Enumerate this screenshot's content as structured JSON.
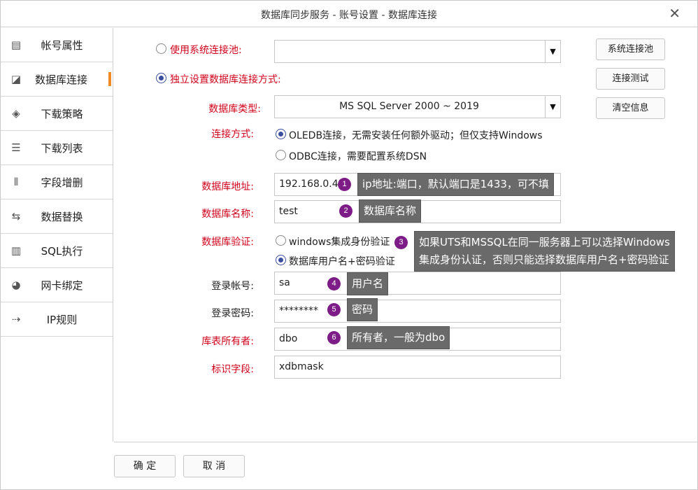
{
  "window": {
    "title": "数据库同步服务 - 账号设置 - 数据库连接",
    "close_symbol": "✕"
  },
  "sidebar": {
    "items": [
      {
        "label": "帐号属性",
        "icon": "id-card-icon",
        "glyph": "▤"
      },
      {
        "label": "数据库连接",
        "icon": "chart-line-icon",
        "glyph": "◪",
        "active": true
      },
      {
        "label": "下载策略",
        "icon": "diamond-icon",
        "glyph": "◈"
      },
      {
        "label": "下载列表",
        "icon": "list-icon",
        "glyph": "☰"
      },
      {
        "label": "字段增删",
        "icon": "columns-icon",
        "glyph": "⦀"
      },
      {
        "label": "数据替换",
        "icon": "swap-icon",
        "glyph": "⇆"
      },
      {
        "label": "SQL执行",
        "icon": "bar-chart-icon",
        "glyph": "▥"
      },
      {
        "label": "网卡绑定",
        "icon": "pie-icon",
        "glyph": "◕"
      },
      {
        "label": "IP规则",
        "icon": "route-icon",
        "glyph": "⇢"
      }
    ],
    "active_color": "#f08a24"
  },
  "connection": {
    "use_pool_label": "使用系统连接池:",
    "pool_value": "",
    "independent_label": "独立设置数据库连接方式:",
    "db_type_label": "数据库类型:",
    "db_type_value": "MS SQL Server 2000 ~ 2019",
    "conn_mode_label": "连接方式:",
    "oledb_option": "OLEDB连接，无需安装任何额外驱动；但仅支持Windows",
    "odbc_option": "ODBC连接，需要配置系统DSN",
    "address_label": "数据库地址:",
    "address_value": "192.168.0.43",
    "name_label": "数据库名称:",
    "name_value": "test",
    "auth_label": "数据库验证:",
    "auth_windows": "windows集成身份验证",
    "auth_user": "数据库用户名+密码验证",
    "login_label": "登录帐号:",
    "login_value": "sa",
    "password_label": "登录密码:",
    "password_value": "********",
    "owner_label": "库表所有者:",
    "owner_value": "dbo",
    "id_field_label": "标识字段:",
    "id_field_value": "xdbmask"
  },
  "buttons": {
    "pool": "系统连接池",
    "test": "连接测试",
    "clear": "清空信息",
    "ok": "确 定",
    "cancel": "取 消"
  },
  "tips": [
    {
      "num": "1",
      "text": "ip地址:端口，默认端口是1433，可不填"
    },
    {
      "num": "2",
      "text": "数据库名称"
    },
    {
      "num": "3",
      "line1": "如果UTS和MSSQL在同一服务器上可以选择Windows",
      "line2": "集成身份认证，否则只能选择数据库用户名+密码验证"
    },
    {
      "num": "4",
      "text": "用户名"
    },
    {
      "num": "5",
      "text": "密码"
    },
    {
      "num": "6",
      "text": "所有者，一般为dbo"
    }
  ],
  "select_arrow": "▼",
  "colors": {
    "required_label": "#d0021b",
    "radio_selected": "#3c4ea0",
    "badge": "#7d1c86",
    "tip_bg": "#6a6a6a"
  }
}
